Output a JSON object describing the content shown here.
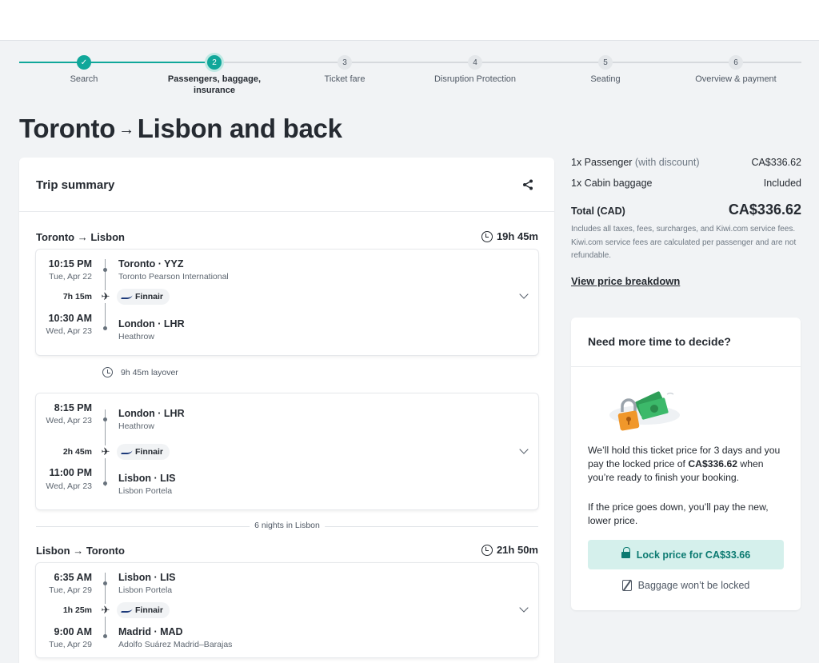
{
  "steps": [
    {
      "label": "Search",
      "mark": "✓"
    },
    {
      "label": "Passengers, baggage, insurance",
      "mark": "2"
    },
    {
      "label": "Ticket fare",
      "mark": "3"
    },
    {
      "label": "Disruption Protection",
      "mark": "4"
    },
    {
      "label": "Seating",
      "mark": "5"
    },
    {
      "label": "Overview & payment",
      "mark": "6"
    }
  ],
  "heading": {
    "from": "Toronto",
    "arrow": "→",
    "rest": "Lisbon and back"
  },
  "trip": {
    "title": "Trip summary",
    "outbound": {
      "title": "Toronto → Lisbon",
      "duration": "19h 45m",
      "seg1": {
        "dep_time": "10:15 PM",
        "dep_date": "Tue, Apr 22",
        "dep_city": "Toronto · YYZ",
        "dep_airport": "Toronto Pearson International",
        "flight_duration": "7h 15m",
        "airline": "Finnair",
        "arr_time": "10:30 AM",
        "arr_date": "Wed, Apr 23",
        "arr_city": "London · LHR",
        "arr_airport": "Heathrow"
      },
      "layover": "9h 45m layover",
      "seg2": {
        "dep_time": "8:15 PM",
        "dep_date": "Wed, Apr 23",
        "dep_city": "London · LHR",
        "dep_airport": "Heathrow",
        "flight_duration": "2h 45m",
        "airline": "Finnair",
        "arr_time": "11:00 PM",
        "arr_date": "Wed, Apr 23",
        "arr_city": "Lisbon · LIS",
        "arr_airport": "Lisbon Portela"
      }
    },
    "nights": "6 nights in Lisbon",
    "inbound": {
      "title": "Lisbon → Toronto",
      "duration": "21h 50m",
      "seg1": {
        "dep_time": "6:35 AM",
        "dep_date": "Tue, Apr 29",
        "dep_city": "Lisbon · LIS",
        "dep_airport": "Lisbon Portela",
        "flight_duration": "1h 25m",
        "airline": "Finnair",
        "arr_time": "9:00 AM",
        "arr_date": "Tue, Apr 29",
        "arr_city": "Madrid · MAD",
        "arr_airport": "Adolfo Suárez Madrid–Barajas"
      }
    }
  },
  "price": {
    "passenger_label": "1x Passenger",
    "passenger_note": "(with discount)",
    "passenger_value": "CA$336.62",
    "cabin_label": "1x Cabin baggage",
    "cabin_value": "Included",
    "total_label": "Total (CAD)",
    "total_value": "CA$336.62",
    "fine_print": "Includes all taxes, fees, surcharges, and Kiwi.com service fees. Kiwi.com service fees are calculated per passenger and are not refundable.",
    "breakdown_link": "View price breakdown"
  },
  "hold": {
    "title": "Need more time to decide?",
    "text1_a": "We’ll hold this ticket price for 3 days and you pay the locked price of ",
    "text1_price": "CA$336.62",
    "text1_b": " when you’re ready to finish your booking.",
    "text2": "If the price goes down, you’ll pay the new, lower price.",
    "button": "Lock price for CA$33.66",
    "baggage_note": "Baggage won’t be locked"
  },
  "colors": {
    "accent": "#10a79a",
    "accent_light": "#d5f0ec",
    "background": "#f1f3f5"
  }
}
